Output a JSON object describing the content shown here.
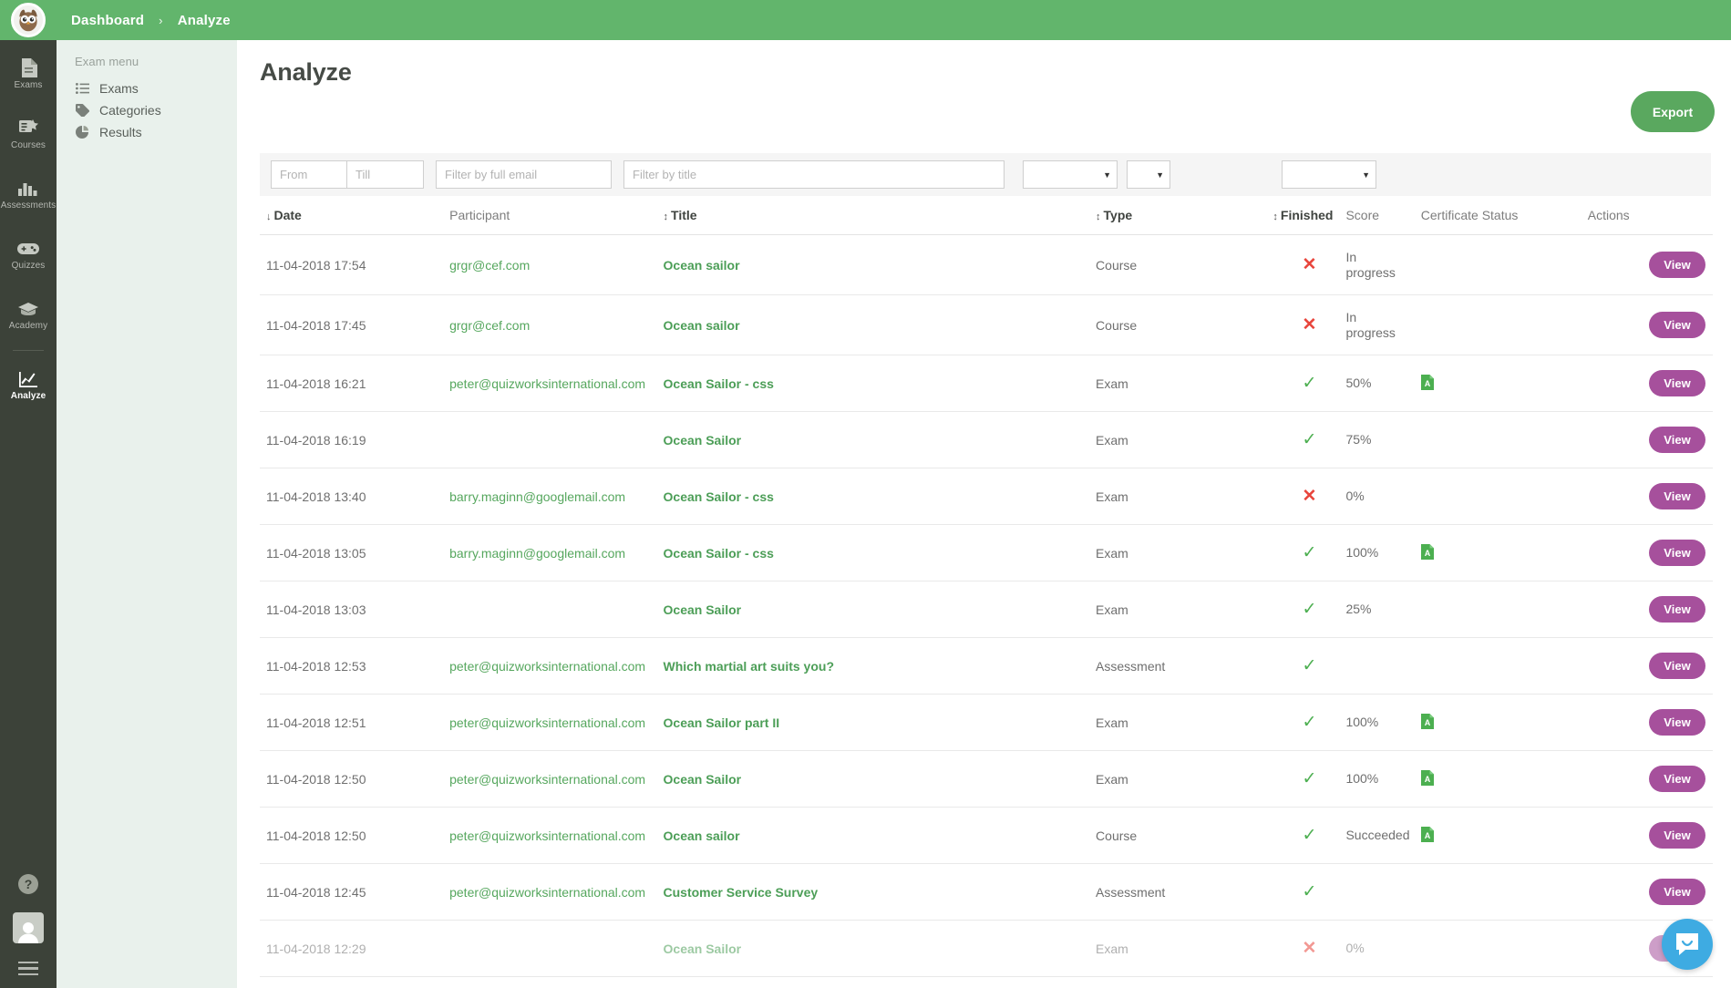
{
  "theme": {
    "brand_green": "#62b56c",
    "rail_dark": "#3c4239",
    "submenu_bg": "#e9f1ec",
    "view_purple": "#a6509c",
    "export_green": "#5aa85f",
    "link_green": "#56a75e",
    "tick_green": "#4caf50",
    "cross_red": "#e8453c",
    "chat_blue": "#3eabe2"
  },
  "topbar": {
    "logo_alt": "owl-logo",
    "breadcrumb": [
      {
        "label": "Dashboard"
      },
      {
        "label": "Analyze"
      }
    ],
    "separator": "›"
  },
  "rail": {
    "items": [
      {
        "label": "Exams",
        "icon": "document-icon",
        "active": false
      },
      {
        "label": "Courses",
        "icon": "course-icon",
        "active": false
      },
      {
        "label": "Assessments",
        "icon": "bar-chart-icon",
        "active": false
      },
      {
        "label": "Quizzes",
        "icon": "gamepad-icon",
        "active": false
      },
      {
        "label": "Academy",
        "icon": "graduation-cap-icon",
        "active": false
      },
      {
        "label": "Analyze",
        "icon": "line-chart-icon",
        "active": true
      }
    ],
    "help_label": "?",
    "avatar_alt": "user-avatar",
    "menu_alt": "hamburger-menu"
  },
  "submenu": {
    "title": "Exam menu",
    "items": [
      {
        "label": "Exams",
        "icon": "list-icon"
      },
      {
        "label": "Categories",
        "icon": "tag-icon"
      },
      {
        "label": "Results",
        "icon": "pie-chart-icon"
      }
    ]
  },
  "main": {
    "page_title": "Analyze",
    "export_label": "Export"
  },
  "filters": {
    "from_placeholder": "From",
    "from_value": "",
    "till_placeholder": "Till",
    "till_value": "",
    "email_placeholder": "Filter by full email",
    "email_value": "",
    "title_placeholder": "Filter by title",
    "title_value": "",
    "type_value": "",
    "finished_value": "",
    "certificate_value": "",
    "caret": "▼"
  },
  "table": {
    "columns": [
      {
        "key": "date",
        "label": "Date",
        "sort": "desc",
        "sort_glyph": "↓"
      },
      {
        "key": "part",
        "label": "Participant",
        "sort": "none",
        "sort_glyph": ""
      },
      {
        "key": "title",
        "label": "Title",
        "sort": "both",
        "sort_glyph": "↕"
      },
      {
        "key": "type",
        "label": "Type",
        "sort": "both",
        "sort_glyph": "↕"
      },
      {
        "key": "fin",
        "label": "Finished",
        "sort": "both",
        "sort_glyph": "↕"
      },
      {
        "key": "score",
        "label": "Score",
        "sort": "none",
        "sort_glyph": ""
      },
      {
        "key": "cert",
        "label": "Certificate Status",
        "sort": "none",
        "sort_glyph": ""
      },
      {
        "key": "actions",
        "label": "Actions",
        "sort": "none",
        "sort_glyph": ""
      }
    ],
    "action_label": "View",
    "tick_glyph": "✓",
    "cross_glyph": "✕",
    "rows": [
      {
        "date": "11-04-2018 17:54",
        "participant": "grgr@cef.com",
        "title": "Ocean sailor",
        "type": "Course",
        "finished": false,
        "score": "In progress",
        "certificate": false
      },
      {
        "date": "11-04-2018 17:45",
        "participant": "grgr@cef.com",
        "title": "Ocean sailor",
        "type": "Course",
        "finished": false,
        "score": "In progress",
        "certificate": false
      },
      {
        "date": "11-04-2018 16:21",
        "participant": "peter@quizworksinternational.com",
        "title": "Ocean Sailor - css",
        "type": "Exam",
        "finished": true,
        "score": "50%",
        "certificate": true
      },
      {
        "date": "11-04-2018 16:19",
        "participant": "",
        "title": "Ocean Sailor",
        "type": "Exam",
        "finished": true,
        "score": "75%",
        "certificate": false
      },
      {
        "date": "11-04-2018 13:40",
        "participant": "barry.maginn@googlemail.com",
        "title": "Ocean Sailor - css",
        "type": "Exam",
        "finished": false,
        "score": "0%",
        "certificate": false
      },
      {
        "date": "11-04-2018 13:05",
        "participant": "barry.maginn@googlemail.com",
        "title": "Ocean Sailor - css",
        "type": "Exam",
        "finished": true,
        "score": "100%",
        "certificate": true
      },
      {
        "date": "11-04-2018 13:03",
        "participant": "",
        "title": "Ocean Sailor",
        "type": "Exam",
        "finished": true,
        "score": "25%",
        "certificate": false
      },
      {
        "date": "11-04-2018 12:53",
        "participant": "peter@quizworksinternational.com",
        "title": "Which martial art suits you?",
        "type": "Assessment",
        "finished": true,
        "score": "",
        "certificate": false
      },
      {
        "date": "11-04-2018 12:51",
        "participant": "peter@quizworksinternational.com",
        "title": "Ocean Sailor part II",
        "type": "Exam",
        "finished": true,
        "score": "100%",
        "certificate": true
      },
      {
        "date": "11-04-2018 12:50",
        "participant": "peter@quizworksinternational.com",
        "title": "Ocean Sailor",
        "type": "Exam",
        "finished": true,
        "score": "100%",
        "certificate": true
      },
      {
        "date": "11-04-2018 12:50",
        "participant": "peter@quizworksinternational.com",
        "title": "Ocean sailor",
        "type": "Course",
        "finished": true,
        "score": "Succeeded",
        "certificate": true
      },
      {
        "date": "11-04-2018 12:45",
        "participant": "peter@quizworksinternational.com",
        "title": "Customer Service Survey",
        "type": "Assessment",
        "finished": true,
        "score": "",
        "certificate": false
      },
      {
        "date": "11-04-2018 12:29",
        "participant": "",
        "title": "Ocean Sailor",
        "type": "Exam",
        "finished": false,
        "score": "0%",
        "certificate": false
      }
    ]
  },
  "chat": {
    "alt": "intercom-chat-launcher"
  }
}
